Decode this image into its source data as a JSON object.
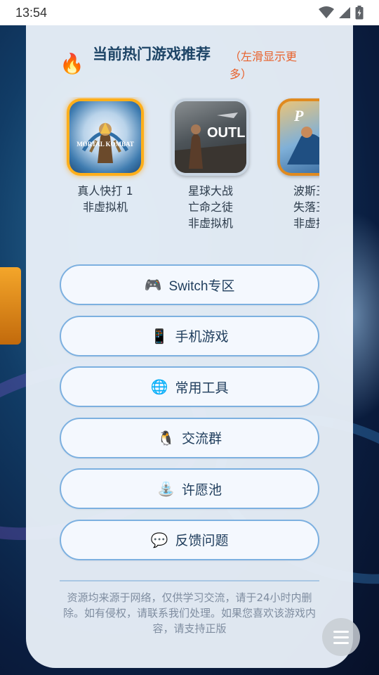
{
  "status_bar": {
    "time": "13:54"
  },
  "hot": {
    "title": "当前热门游戏推荐",
    "hint": "（左滑显示更多）",
    "fire_icon": "🔥",
    "games": [
      {
        "name": "真人快打 1\n非虚拟机",
        "thumb_text": "MORTAL KOMBAT",
        "highlight": true
      },
      {
        "name": "星球大战\n亡命之徒\n非虚拟机",
        "thumb_text": "OUTL"
      },
      {
        "name": "波斯王子\n失落王冠\n非虚拟机",
        "thumb_text": "P"
      }
    ]
  },
  "menu": [
    {
      "icon": "🎮",
      "label": "Switch专区"
    },
    {
      "icon": "📱",
      "label": "手机游戏"
    },
    {
      "icon": "🌐",
      "label": "常用工具"
    },
    {
      "icon": "🐧",
      "label": "交流群"
    },
    {
      "icon": "⛲",
      "label": "许愿池"
    },
    {
      "icon": "💬",
      "label": "反馈问题"
    }
  ],
  "footer": "资源均来源于网络，仅供学习交流，请于24小时内删除。如有侵权，请联系我们处理。如果您喜欢该游戏内容，请支持正版",
  "colors": {
    "accent": "#7cb0e0",
    "hint": "#e8602a",
    "title": "#1d4466",
    "highlight": "#ffaf1a"
  }
}
